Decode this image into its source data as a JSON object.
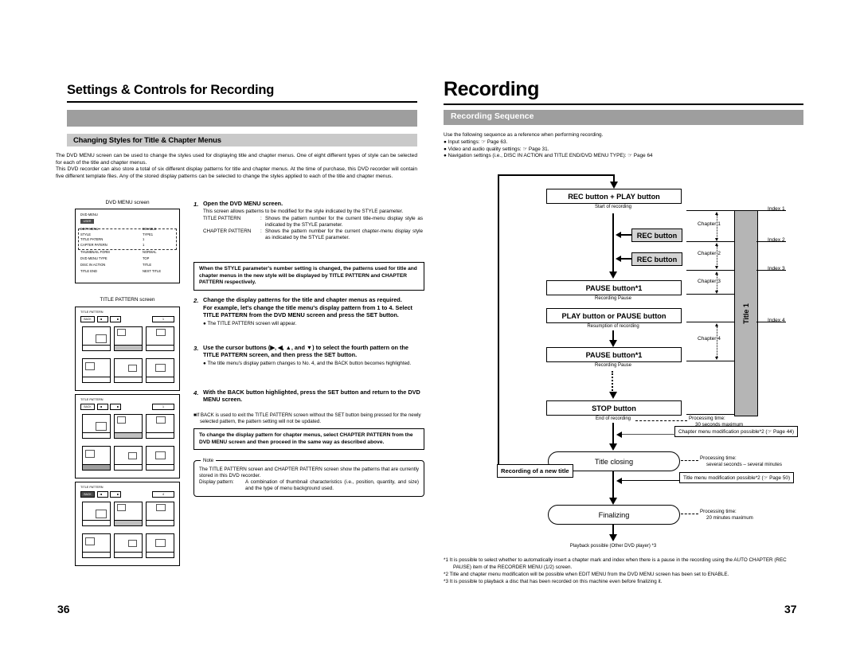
{
  "left_page": {
    "number": "36",
    "title": "Settings & Controls for Recording",
    "section_heading": "Changing Styles for Title & Chapter Menus",
    "intro": [
      "The DVD MENU screen can be used to change the styles used for displaying title and chapter menus. One of eight different types of style can be selected for each of the title and chapter menus.",
      "This DVD recorder can also store a total of six different display patterns for title and chapter menus. At the time of purchase, this DVD recorder will contain five different template files. Any of the stored display patterns can be selected to change the styles applied to each of the title and chapter menus."
    ],
    "illustrations": {
      "dvd_menu_caption": "DVD MENU screen",
      "dvd_menu_screen": {
        "title": "DVD MENU",
        "chip": "USER",
        "rows": [
          {
            "key": "EDIT MENU",
            "value": "DISABLE"
          },
          {
            "key": "STYLE",
            "value": "TYPE1"
          },
          {
            "key": "TITLE PATERN",
            "value": "1"
          },
          {
            "key": "CAPTER PATERN",
            "value": "1"
          },
          {
            "key": "THUMBNAIL FORM",
            "value": "NORMAL"
          },
          {
            "key": "DVD MENU TYPE",
            "value": "TOP"
          },
          {
            "key": "DISC IN ACTION",
            "value": "TITLE"
          },
          {
            "key": "TITLE END",
            "value": "NEXT TITLE"
          }
        ]
      },
      "title_pattern_caption": "TITLE PATTERN screen",
      "title_pattern_screens": [
        {
          "label": "TITLE PATTERN",
          "back": "BACK",
          "num": "1",
          "back_highlighted": false,
          "selected": -1
        },
        {
          "label": "TITLE PATTERN",
          "back": "BACK",
          "num": "1",
          "back_highlighted": false,
          "selected": 3
        },
        {
          "label": "TITLE PATTERN",
          "back": "BACK",
          "num": "4",
          "back_highlighted": true,
          "selected": -1
        }
      ]
    },
    "steps": [
      {
        "no": "1.",
        "heading": "Open the DVD MENU screen.",
        "text": "This screen allows patterns to be modified for the style indicated by the STYLE parameter.",
        "definitions": [
          {
            "term": "TITLE PATTERN",
            "desc": "Shows the pattern number for the current title-menu display style as indicated by the STYLE parameter."
          },
          {
            "term": "CHAPTER PATTERN",
            "desc": "Shows the pattern number for the current chapter-menu display style as indicated by the STYLE parameter."
          }
        ]
      },
      {
        "no": "2.",
        "heading": "Change the display patterns for the title and chapter menus as required.",
        "text": "For example, let's change the title menu's display pattern from 1 to 4. Select TITLE PATTERN from the DVD MENU screen and press the SET button.",
        "bullet": "The TITLE PATTERN screen will appear."
      },
      {
        "no": "3.",
        "heading": "Use the cursor buttons (▶, ◀, ▲, and ▼) to select the fourth pattern on the TITLE PATTERN screen, and then press the SET button.",
        "bullet": "The title menu's display pattern changes to No. 4, and the BACK button becomes highlighted."
      },
      {
        "no": "4.",
        "heading": "With the BACK button highlighted, press the SET button and return to the DVD MENU screen."
      }
    ],
    "callout_style": "When the STYLE parameter's number setting is changed, the patterns used for title and chapter menus in the new style will be displayed by TITLE PATTERN and CHAPTER PATTERN respectively.",
    "square_bullet": "If BACK is used to exit the TITLE PATTERN screen without the SET button being pressed for the newly selected pattern, the pattern setting will not be updated.",
    "callout_chapter": "To change the display pattern for chapter menus, select CHAPTER PATTERN from the DVD MENU screen and then proceed in the same way as described above.",
    "note": {
      "title": "Note",
      "lines": [
        "The TITLE PATTERN screen and CHAPTER PATTERN screen show the patterns that are currently stored in this DVD recorder.",
        "Display pattern:",
        "A combination of thumbnail characteristics (i.e., position, quantity, and size) and the type of menu background used."
      ]
    }
  },
  "right_page": {
    "number": "37",
    "title": "Recording",
    "section_heading": "Recording Sequence",
    "intro_lead": "Use the following sequence as a reference when performing recording.",
    "intro_bullets": [
      "Input settings: ☞ Page 63.",
      "Video and audio quality settings: ☞ Page 31.",
      "Navigation settings (i.e., DISC IN ACTION and TITLE END/DVD MENU TYPE): ☞ Page 64"
    ],
    "flow": {
      "boxes": [
        {
          "id": "rec-play",
          "label": "REC button + PLAY button",
          "caption": "Start of recording",
          "style": "plain"
        },
        {
          "id": "rec-1",
          "label": "REC button",
          "style": "gray"
        },
        {
          "id": "rec-2",
          "label": "REC button",
          "style": "gray"
        },
        {
          "id": "pause-1",
          "label": "PAUSE button*1",
          "caption": "Recording Pause",
          "style": "plain"
        },
        {
          "id": "play-or-pause",
          "label": "PLAY button or PAUSE button",
          "caption": "Resumption of recording",
          "style": "plain"
        },
        {
          "id": "pause-2",
          "label": "PAUSE button*1",
          "caption": "Recording Pause",
          "style": "plain"
        },
        {
          "id": "stop",
          "label": "STOP button",
          "caption": "End of recording",
          "style": "plain"
        }
      ],
      "pills": [
        {
          "id": "title-closing",
          "label": "Title closing"
        },
        {
          "id": "finalizing",
          "label": "Finalizing"
        }
      ],
      "loop_label": "Recording of a new title",
      "title_bar_label": "Title 1",
      "indexes": [
        "Index 1",
        "Index 2",
        "Index 3",
        "Index 4"
      ],
      "chapters": [
        "Chapter 1",
        "Chapter 2",
        "Chapter 3",
        "Chapter 4"
      ],
      "processing_times": [
        {
          "id": "pt-stop",
          "l1": "Processing time:",
          "l2": "30 seconds maximum"
        },
        {
          "id": "pt-closing",
          "l1": "Processing time:",
          "l2": "several seconds – several minutes"
        },
        {
          "id": "pt-final",
          "l1": "Processing time:",
          "l2": "20 minutes maximum"
        }
      ],
      "callouts": [
        {
          "id": "chapter-menu-mod",
          "label": "Chapter menu modification possible*2 (☞ Page 44)"
        },
        {
          "id": "title-menu-mod",
          "label": "Title menu modification possible*2 (☞ Page 50)"
        }
      ],
      "final_label": "Playback possible (Other DVD player) *3"
    },
    "footnotes": [
      "*1 It is possible to select whether to automatically insert a chapter mark and index when there is a pause in the recording using the AUTO CHAPTER (REC PAUSE) item of the RECORDER MENU (1/2) screen.",
      "*2 Title and chapter menu modification will be possible when EDIT MENU from the DVD MENU screen has been set to ENABLE.",
      "*3 It is possible to playback a disc that has been recorded on this machine even before finalizing it."
    ]
  }
}
